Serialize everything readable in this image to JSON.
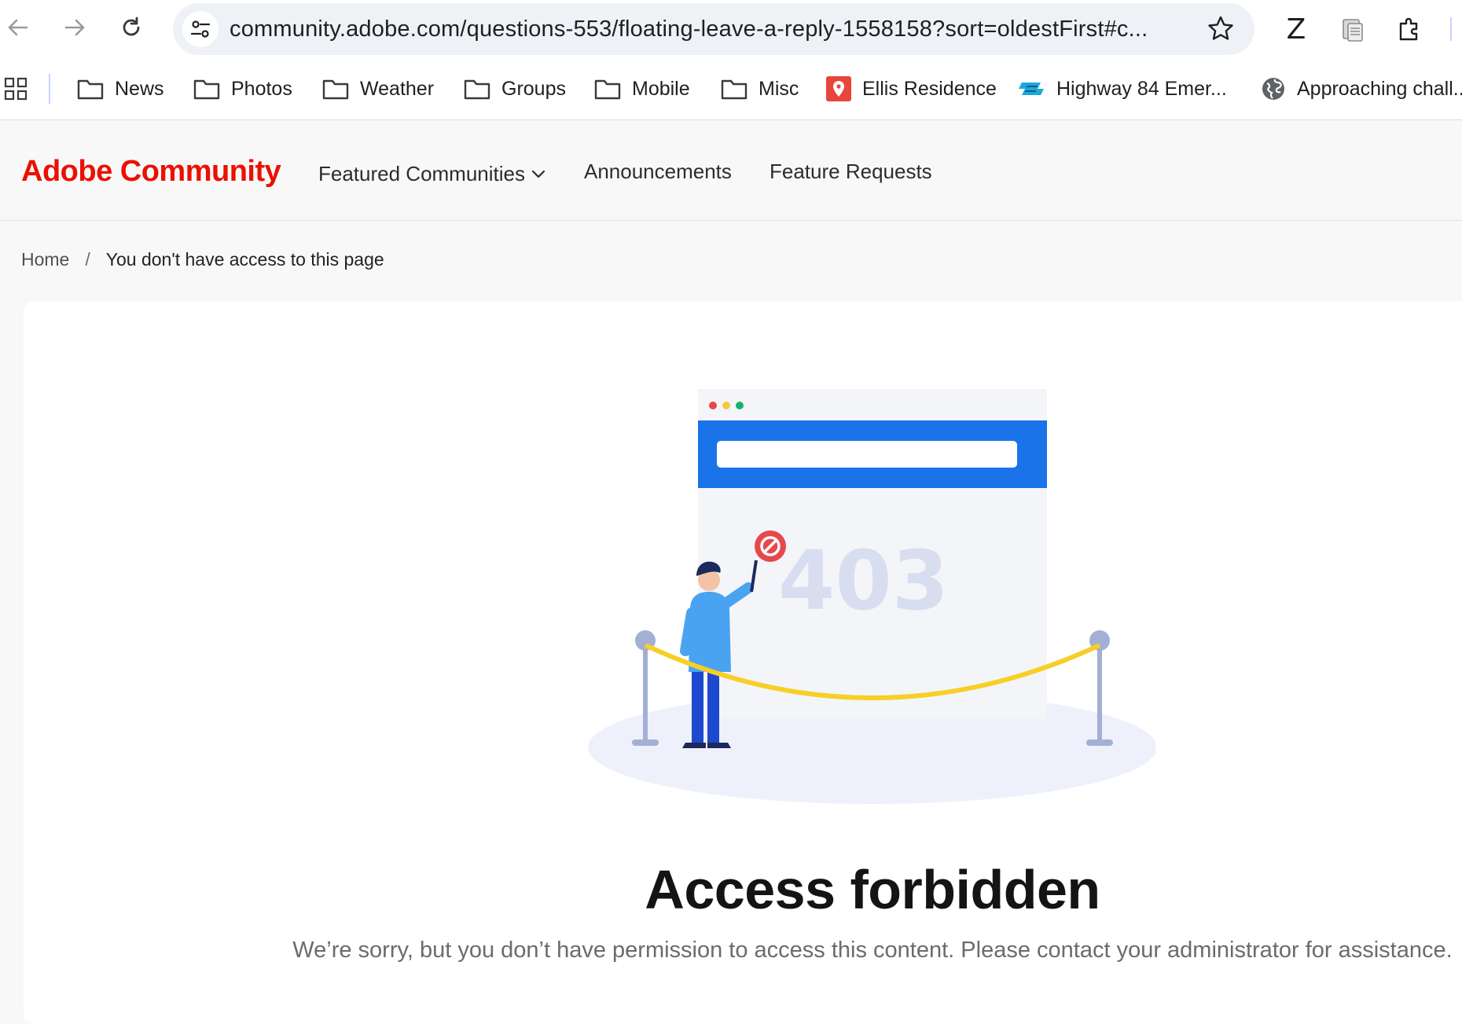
{
  "browser": {
    "url": "community.adobe.com/questions-553/floating-leave-a-reply-1558158?sort=oldestFirst#c...",
    "ext_z_label": "Z"
  },
  "bookmarks": [
    {
      "label": "News",
      "icon": "folder-icon"
    },
    {
      "label": "Photos",
      "icon": "folder-icon"
    },
    {
      "label": "Weather",
      "icon": "folder-icon"
    },
    {
      "label": "Groups",
      "icon": "folder-icon"
    },
    {
      "label": "Mobile",
      "icon": "folder-icon"
    },
    {
      "label": "Misc",
      "icon": "folder-icon"
    },
    {
      "label": "Ellis Residence",
      "icon": "map-pin-icon"
    },
    {
      "label": "Highway 84 Emer...",
      "icon": "highway-icon"
    },
    {
      "label": "Approaching chall...",
      "icon": "globe-icon"
    }
  ],
  "site": {
    "brand": "Adobe Community",
    "brand_color": "#eb1000",
    "nav": [
      {
        "label": "Featured Communities",
        "has_dropdown": true
      },
      {
        "label": "Announcements"
      },
      {
        "label": "Feature Requests"
      }
    ]
  },
  "breadcrumb": {
    "home": "Home",
    "separator": "/",
    "current": "You don't have access to this page"
  },
  "error": {
    "code": "403",
    "title": "Access forbidden",
    "message": "We’re sorry, but you don’t have permission to access this content. Please contact your administrator for assistance."
  }
}
